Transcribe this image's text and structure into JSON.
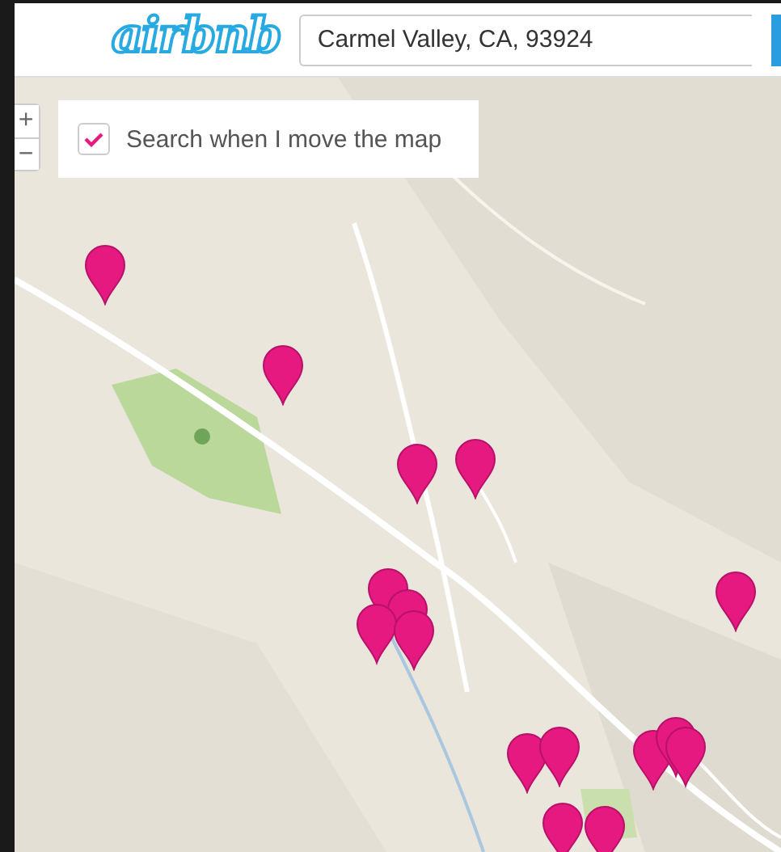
{
  "header": {
    "logo": "airbnb",
    "search": {
      "value": "Carmel Valley, CA, 93924"
    }
  },
  "map": {
    "kind": "picture",
    "zoom_in": "+",
    "zoom_out": "−",
    "auto_search": {
      "label": "Search when I move the map",
      "checked": true
    }
  }
}
